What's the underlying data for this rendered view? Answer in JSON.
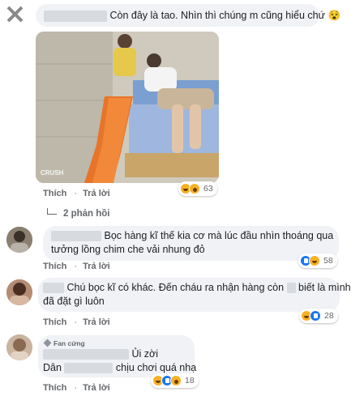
{
  "comment1": {
    "text": "Còn đây là tao. Nhìn thì chúng m cũng hiểu chứ",
    "emoji": "😵",
    "photo_watermark": "CRUSH",
    "actions": {
      "like": "Thích",
      "reply": "Trả lời"
    },
    "reactions": {
      "count": "63",
      "types": [
        "haha-icon",
        "wow-icon"
      ]
    },
    "replies_toggle": "2 phản hồi"
  },
  "comment2": {
    "line1": "Bọc hàng kĩ thế kia cơ mà lúc đầu nhìn thoáng qua",
    "line2": "tưởng lồng chim che vải nhung đỏ",
    "actions": {
      "like": "Thích",
      "reply": "Trả lời"
    },
    "reactions": {
      "count": "58",
      "types": [
        "like-icon",
        "haha-icon"
      ]
    }
  },
  "comment3": {
    "line1_a": "Chú bọc kĩ có khác. Đến cháu ra nhận hàng còn",
    "line1_b": "biết là mình",
    "line2": "đã đặt gì luôn",
    "actions": {
      "like": "Thích",
      "reply": "Trả lời"
    },
    "reactions": {
      "count": "28",
      "types": [
        "haha-icon",
        "like-icon"
      ]
    }
  },
  "comment4": {
    "badge": "Fan cứng",
    "line1": "Ủi zời",
    "line2_a": "Dân",
    "line2_b": "chịu chơi quá nhạ",
    "actions": {
      "like": "Thích",
      "reply": "Trả lời"
    },
    "reactions": {
      "count": "18",
      "types": [
        "haha-icon",
        "like-icon",
        "wow-icon"
      ]
    }
  },
  "colors": {
    "bubble": "#f0f2f5",
    "meta": "#65676b",
    "like_blue": "#1877f2",
    "haha_yellow": "#f7b125"
  }
}
